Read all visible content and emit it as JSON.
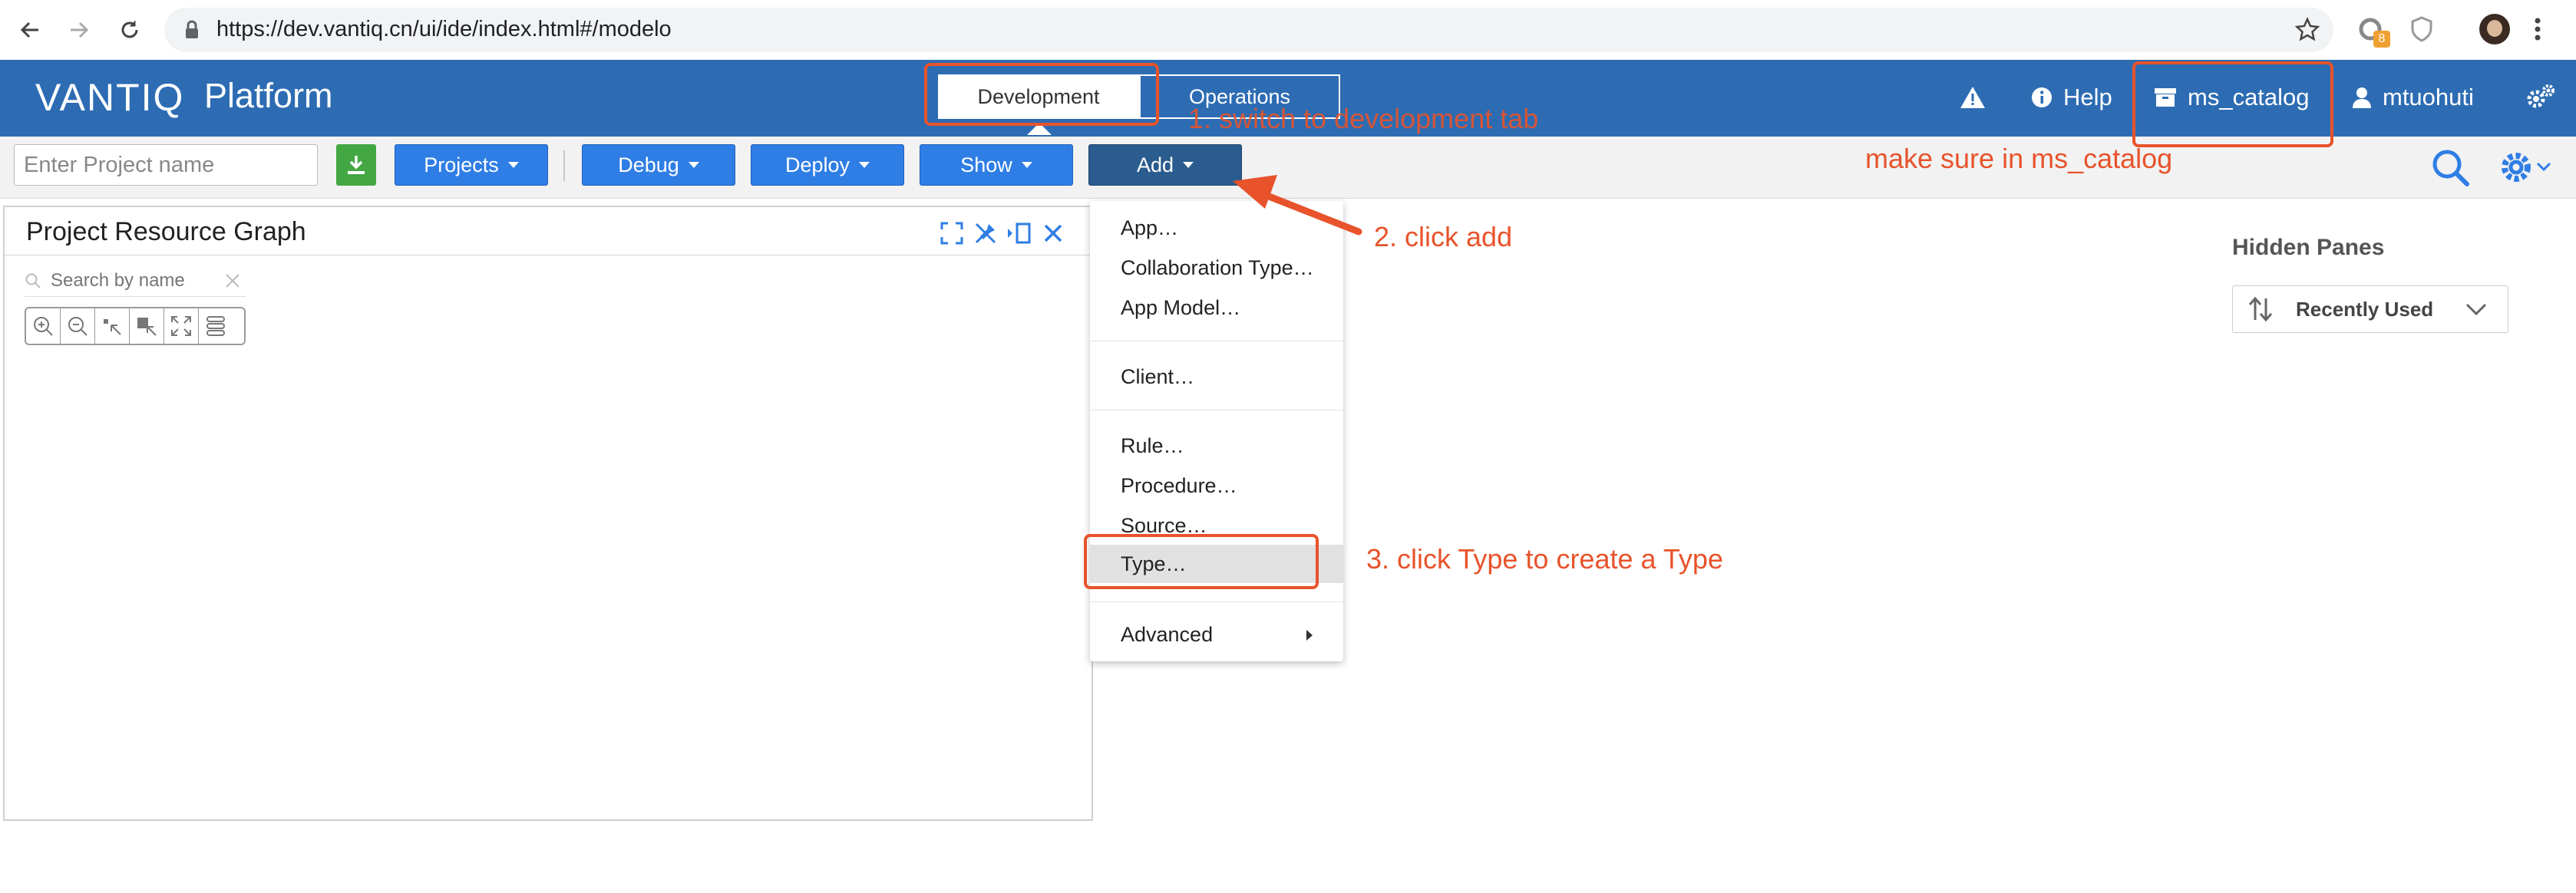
{
  "browser": {
    "url": "https://dev.vantiq.cn/ui/ide/index.html#/modelo",
    "extension_badge": "8"
  },
  "header": {
    "logo_text": "VANTIQ",
    "platform_label": "Platform",
    "tabs": [
      {
        "label": "Development",
        "active": true
      },
      {
        "label": "Operations",
        "active": false
      }
    ],
    "help_label": "Help",
    "namespace_label": "ms_catalog",
    "user_label": "mtuohuti",
    "header_color": "#2d6cb3"
  },
  "toolbar": {
    "project_placeholder": "Enter Project name",
    "buttons": [
      {
        "label": "Projects"
      },
      {
        "label": "Debug"
      },
      {
        "label": "Deploy"
      },
      {
        "label": "Show"
      },
      {
        "label": "Add"
      }
    ],
    "button_color": "#2f7ee5",
    "active_button_color": "#2b5c8f"
  },
  "graph_pane": {
    "title": "Project Resource Graph",
    "search_placeholder": "Search by name"
  },
  "add_menu": {
    "items": [
      {
        "label": "App…"
      },
      {
        "label": "Collaboration Type…"
      },
      {
        "label": "App Model…"
      },
      {
        "label": "Client…"
      },
      {
        "label": "Rule…"
      },
      {
        "label": "Procedure…"
      },
      {
        "label": "Source…"
      },
      {
        "label": "Type…",
        "highlighted": true
      },
      {
        "label": "Advanced",
        "has_submenu": true
      }
    ]
  },
  "hidden_panes": {
    "title": "Hidden Panes",
    "sort_label": "Recently Used"
  },
  "annotations": {
    "color": "#e8532b",
    "step1": "1. switch to development tab",
    "namespace_note": "make sure in ms_catalog",
    "step2": "2. click add",
    "step3": "3. click Type to create a Type"
  }
}
